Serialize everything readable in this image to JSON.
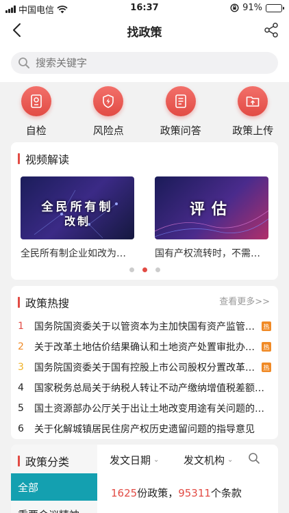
{
  "status_bar": {
    "carrier": "中国电信",
    "time": "16:37",
    "battery": "91%",
    "battery_level": 0.91
  },
  "navbar": {
    "title": "找政策"
  },
  "search": {
    "placeholder": "搜索关键字"
  },
  "quick_actions": [
    {
      "label": "自检",
      "icon": "certificate-icon"
    },
    {
      "label": "风险点",
      "icon": "shield-bolt-icon"
    },
    {
      "label": "政策问答",
      "icon": "document-list-icon"
    },
    {
      "label": "政策上传",
      "icon": "folder-upload-icon"
    }
  ],
  "video_section": {
    "title": "视频解读",
    "videos": [
      {
        "thumb_line1": "全民所有制",
        "thumb_line2": "改制",
        "caption": "全民所有制企业如改为有限责任公司"
      },
      {
        "thumb_line1": "评估",
        "thumb_line2": "",
        "caption": "国有产权流转时，不需要评估的情形"
      }
    ],
    "active_dot": 1
  },
  "hot_section": {
    "title": "政策热搜",
    "more": "查看更多>>",
    "hot_tag": "热",
    "items": [
      {
        "rank": "1",
        "text": "国务院国资委关于以管资本为主加快国有资产监管职能转变的实施意见",
        "hot": true
      },
      {
        "rank": "2",
        "text": "关于改革土地估价结果确认和土地资产处置审批办法的通知",
        "hot": true
      },
      {
        "rank": "3",
        "text": "国务院国资委关于国有控股上市公司股权分置改革的指导意见",
        "hot": true
      },
      {
        "rank": "4",
        "text": "国家税务总局关于纳税人转让不动产缴纳增值税差额扣除有关问题的公告",
        "hot": false
      },
      {
        "rank": "5",
        "text": "国土资源部办公厅关于出让土地改变用途有关问题的复函",
        "hot": false
      },
      {
        "rank": "6",
        "text": "关于化解城镇居民住房产权历史遗留问题的指导意见",
        "hot": false
      }
    ]
  },
  "category_section": {
    "title": "政策分类",
    "all_label": "全部",
    "next_label": "重要会议精神",
    "filter_date": "发文日期",
    "filter_org": "发文机构",
    "policy_count": "1625",
    "policy_unit": "份政策，",
    "clause_count": "95311",
    "clause_unit": "个条款"
  },
  "colors": {
    "accent": "#e24b44",
    "teal": "#14a0b0",
    "hot_orange": "#f08a26"
  }
}
